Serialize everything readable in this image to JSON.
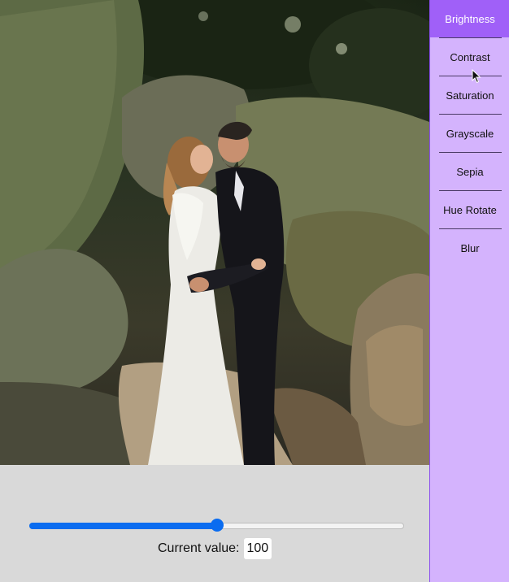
{
  "photo": {
    "alt": "Couple embracing among mossy boulders"
  },
  "filters": {
    "items": [
      {
        "label": "Brightness",
        "active": true
      },
      {
        "label": "Contrast",
        "active": false
      },
      {
        "label": "Saturation",
        "active": false
      },
      {
        "label": "Grayscale",
        "active": false
      },
      {
        "label": "Sepia",
        "active": false
      },
      {
        "label": "Hue Rotate",
        "active": false
      },
      {
        "label": "Blur",
        "active": false
      }
    ]
  },
  "slider": {
    "value_fraction": 0.5
  },
  "current_value": {
    "label": "Current value:",
    "value": "100"
  },
  "colors": {
    "menu_bg": "#d4b3fd",
    "menu_active": "#a060f8",
    "slider_accent": "#0a6cf0",
    "panel_bg": "#d9d9d9"
  }
}
